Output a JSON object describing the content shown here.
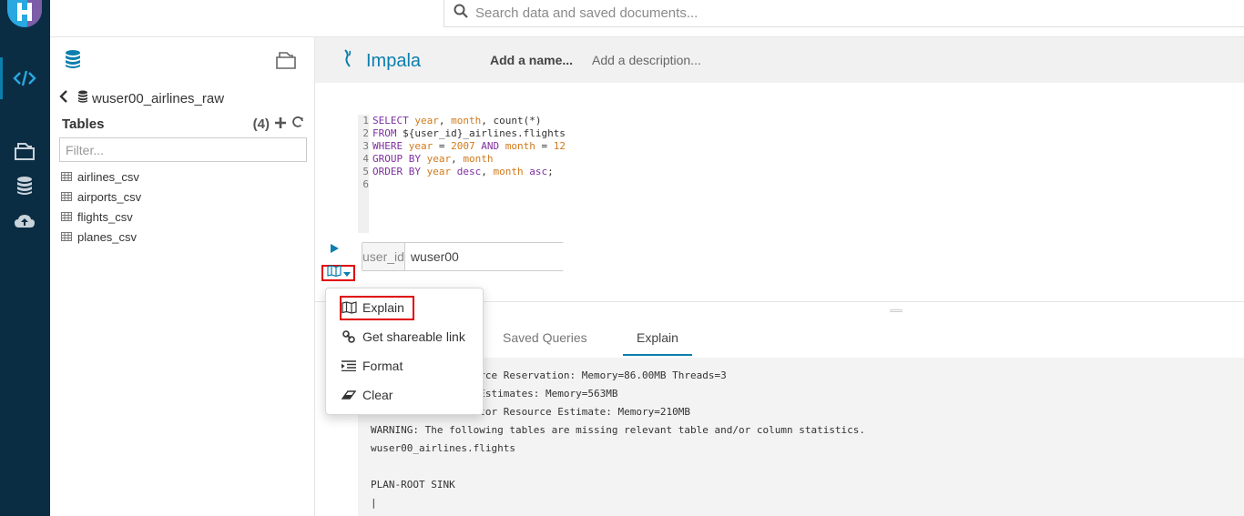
{
  "search": {
    "placeholder": "Search data and saved documents..."
  },
  "assist": {
    "database": "wuser00_airlines_raw",
    "tables_label": "Tables",
    "tables_count": "(4)",
    "filter_placeholder": "Filter...",
    "tables": [
      "airlines_csv",
      "airports_csv",
      "flights_csv",
      "planes_csv"
    ]
  },
  "editor": {
    "engine": "Impala",
    "name_placeholder": "Add a name...",
    "description_placeholder": "Add a description...",
    "code_lines": [
      {
        "num": "1",
        "parts": [
          [
            "kw",
            "SELECT "
          ],
          [
            "id",
            "year"
          ],
          [
            "pl",
            ", "
          ],
          [
            "id",
            "month"
          ],
          [
            "pl",
            ", "
          ],
          [
            "fn",
            "count(*)"
          ]
        ]
      },
      {
        "num": "2",
        "parts": [
          [
            "kw",
            "FROM "
          ],
          [
            "pl",
            "${user_id}_airlines.flights"
          ]
        ]
      },
      {
        "num": "3",
        "parts": [
          [
            "kw",
            "WHERE "
          ],
          [
            "id",
            "year"
          ],
          [
            "pl",
            " = "
          ],
          [
            "id",
            "2007"
          ],
          [
            "kw",
            " AND "
          ],
          [
            "id",
            "month"
          ],
          [
            "pl",
            " = "
          ],
          [
            "id",
            "12"
          ]
        ]
      },
      {
        "num": "4",
        "parts": [
          [
            "kw",
            "GROUP BY "
          ],
          [
            "id",
            "year"
          ],
          [
            "pl",
            ", "
          ],
          [
            "id",
            "month"
          ]
        ]
      },
      {
        "num": "5",
        "parts": [
          [
            "kw",
            "ORDER BY "
          ],
          [
            "id",
            "year"
          ],
          [
            "kw",
            " desc"
          ],
          [
            "pl",
            ", "
          ],
          [
            "id",
            "month"
          ],
          [
            "kw",
            " asc"
          ],
          [
            "pl",
            ";"
          ]
        ]
      },
      {
        "num": "6",
        "parts": []
      }
    ],
    "param_label": "user_id",
    "param_value": "wuser00"
  },
  "menu": {
    "items": [
      {
        "label": "Explain",
        "icon": "map-icon"
      },
      {
        "label": "Get shareable link",
        "icon": "link-icon"
      },
      {
        "label": "Format",
        "icon": "indent-icon"
      },
      {
        "label": "Clear",
        "icon": "eraser-icon"
      }
    ]
  },
  "results": {
    "tabs": [
      "Saved Queries",
      "Explain"
    ],
    "active_tab": "Explain",
    "output_lines": [
      "Max Per-Host Resource Reservation: Memory=86.00MB Threads=3",
      "Per-Host Resource Estimates: Memory=563MB",
      "Dedicated Coordinator Resource Estimate: Memory=210MB",
      "WARNING: The following tables are missing relevant table and/or column statistics.",
      "wuser00_airlines.flights",
      "",
      "PLAN-ROOT SINK",
      "|"
    ]
  },
  "colors": {
    "accent": "#0b7fad",
    "rail": "#0b2d44",
    "highlight": "#e00000"
  }
}
